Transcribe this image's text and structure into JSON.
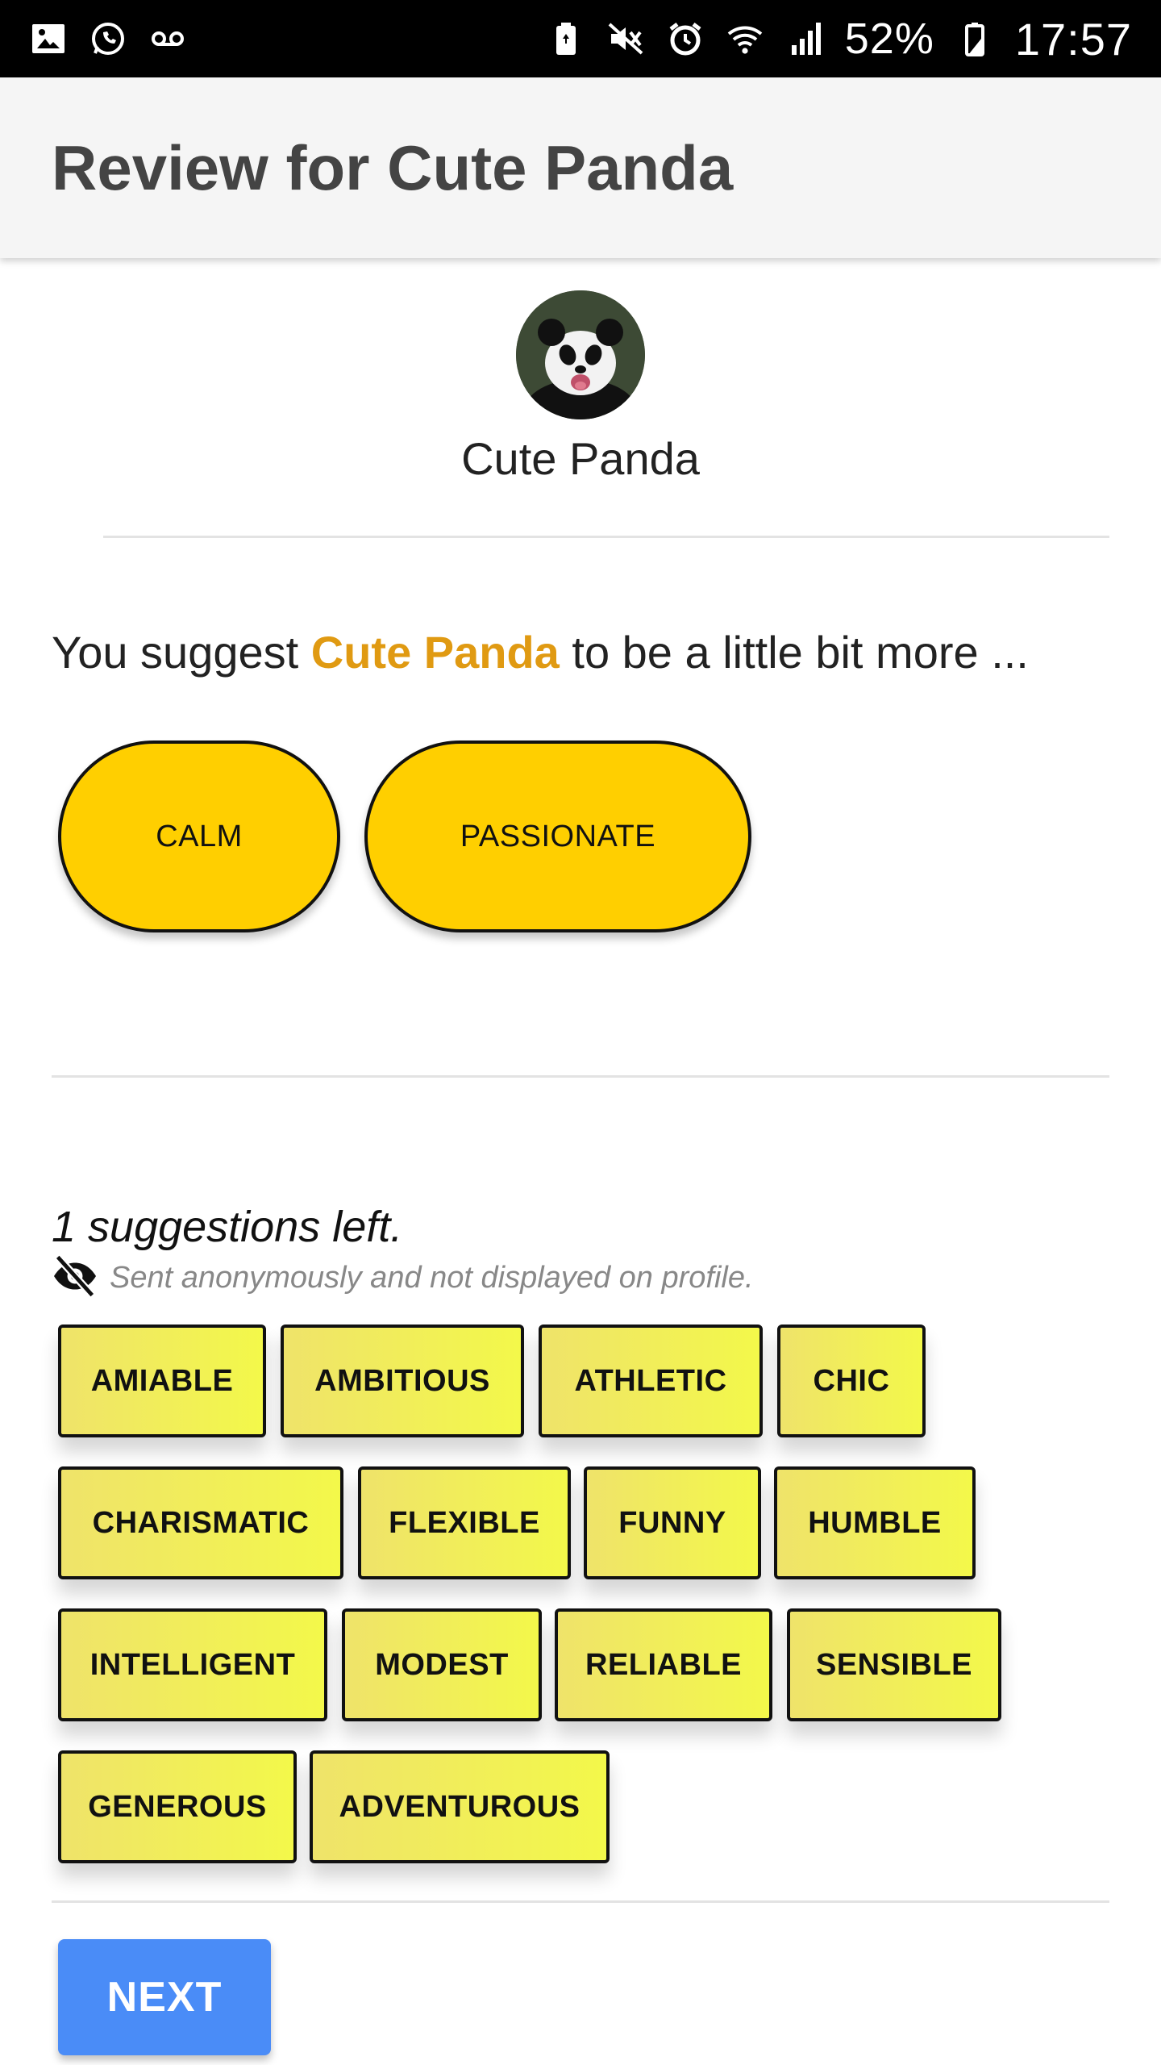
{
  "status_bar": {
    "left_icons": [
      "gallery-icon",
      "whatsapp-icon",
      "voicemail-icon"
    ],
    "right_icons": [
      "battery-saver-icon",
      "mute-icon",
      "alarm-icon",
      "wifi-icon",
      "signal-icon"
    ],
    "battery_percent": "52%",
    "time": "17:57"
  },
  "app_bar": {
    "title": "Review for Cute Panda"
  },
  "profile": {
    "name": "Cute Panda"
  },
  "suggestion": {
    "prefix": "You suggest ",
    "name": "Cute Panda",
    "suffix": " to be a little bit more ..."
  },
  "selected_traits": [
    "CALM",
    "PASSIONATE"
  ],
  "remaining": {
    "text": "1 suggestions left.",
    "anonymous_note": "Sent anonymously and not displayed on profile."
  },
  "traits": [
    "AMIABLE",
    "AMBITIOUS",
    "ATHLETIC",
    "CHIC",
    "CHARISMATIC",
    "FLEXIBLE",
    "FUNNY",
    "HUMBLE",
    "INTELLIGENT",
    "MODEST",
    "RELIABLE",
    "SENSIBLE",
    "GENEROUS",
    "ADVENTUROUS"
  ],
  "next_button": {
    "label": "NEXT"
  },
  "colors": {
    "accent_name": "#e09a12",
    "selected_pill": "#ffcf00",
    "chip": "#f0f04e",
    "next_button": "#4a8cf7"
  }
}
